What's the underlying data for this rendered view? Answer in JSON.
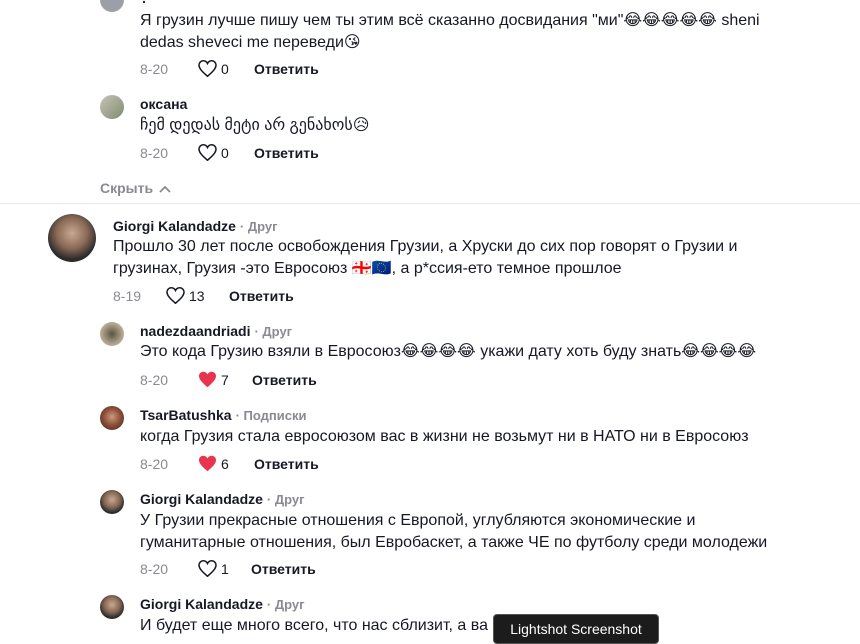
{
  "comments": [
    {
      "id": "c0",
      "username": "?",
      "text": [
        "Я грузин лучше пишу чем ты этим всё сказанно досвидания \"ми\"😂😂😂😂😂 sheni",
        "dedas sheveci me переведи😘"
      ],
      "date": "8-20",
      "likes": "0",
      "reply": "Ответить"
    },
    {
      "id": "c1",
      "username": "оксана",
      "text": [
        "ჩემ დედას მეტი არ გენახოს😥"
      ],
      "date": "8-20",
      "likes": "0",
      "reply": "Ответить"
    },
    {
      "id": "c2",
      "username": "Giorgi Kalandadze",
      "tag": "· Друг",
      "text": [
        "Прошло 30 лет после освобождения Грузии, а Хруски до сих пор говорят о Грузии и",
        "грузинах, Грузия -это Евросоюз 🇬🇪🇪🇺, а р*ссия-ето темное прошлое"
      ],
      "date": "8-19",
      "likes": "13",
      "reply": "Ответить"
    },
    {
      "id": "c3",
      "username": "nadezdaandriadi",
      "tag": "· Друг",
      "text": [
        "Это кода Грузию взяли в Евросоюз😂😂😂😂 укажи дату хоть буду знать😂😂😂😂"
      ],
      "date": "8-20",
      "likes": "7",
      "reply": "Ответить"
    },
    {
      "id": "c4",
      "username": "TsarBatushka",
      "tag": "· Подписки",
      "text": [
        "когда Грузия стала евросоюзом вас в жизни не возьмут ни в НАТО ни в Евросоюз"
      ],
      "date": "8-20",
      "likes": "6",
      "reply": "Ответить"
    },
    {
      "id": "c5",
      "username": "Giorgi Kalandadze",
      "tag": "· Друг",
      "text": [
        "У Грузии прекрасные отношения с Европой, углубляются экономические и",
        "гуманитарные отношения, был Евробаскет, а также ЧЕ по футболу среди молодежи"
      ],
      "date": "8-20",
      "likes": "1",
      "reply": "Ответить"
    },
    {
      "id": "c6",
      "username": "Giorgi Kalandadze",
      "tag": "· Друг",
      "text": [
        "И будет еще много всего, что нас сблизит, а ва"
      ]
    }
  ],
  "hide_replies": "Скрыть",
  "tooltip": "Lightshot Screenshot",
  "colors": {
    "heart_liked": "#fe2c55",
    "muted": "#8a8b91"
  }
}
